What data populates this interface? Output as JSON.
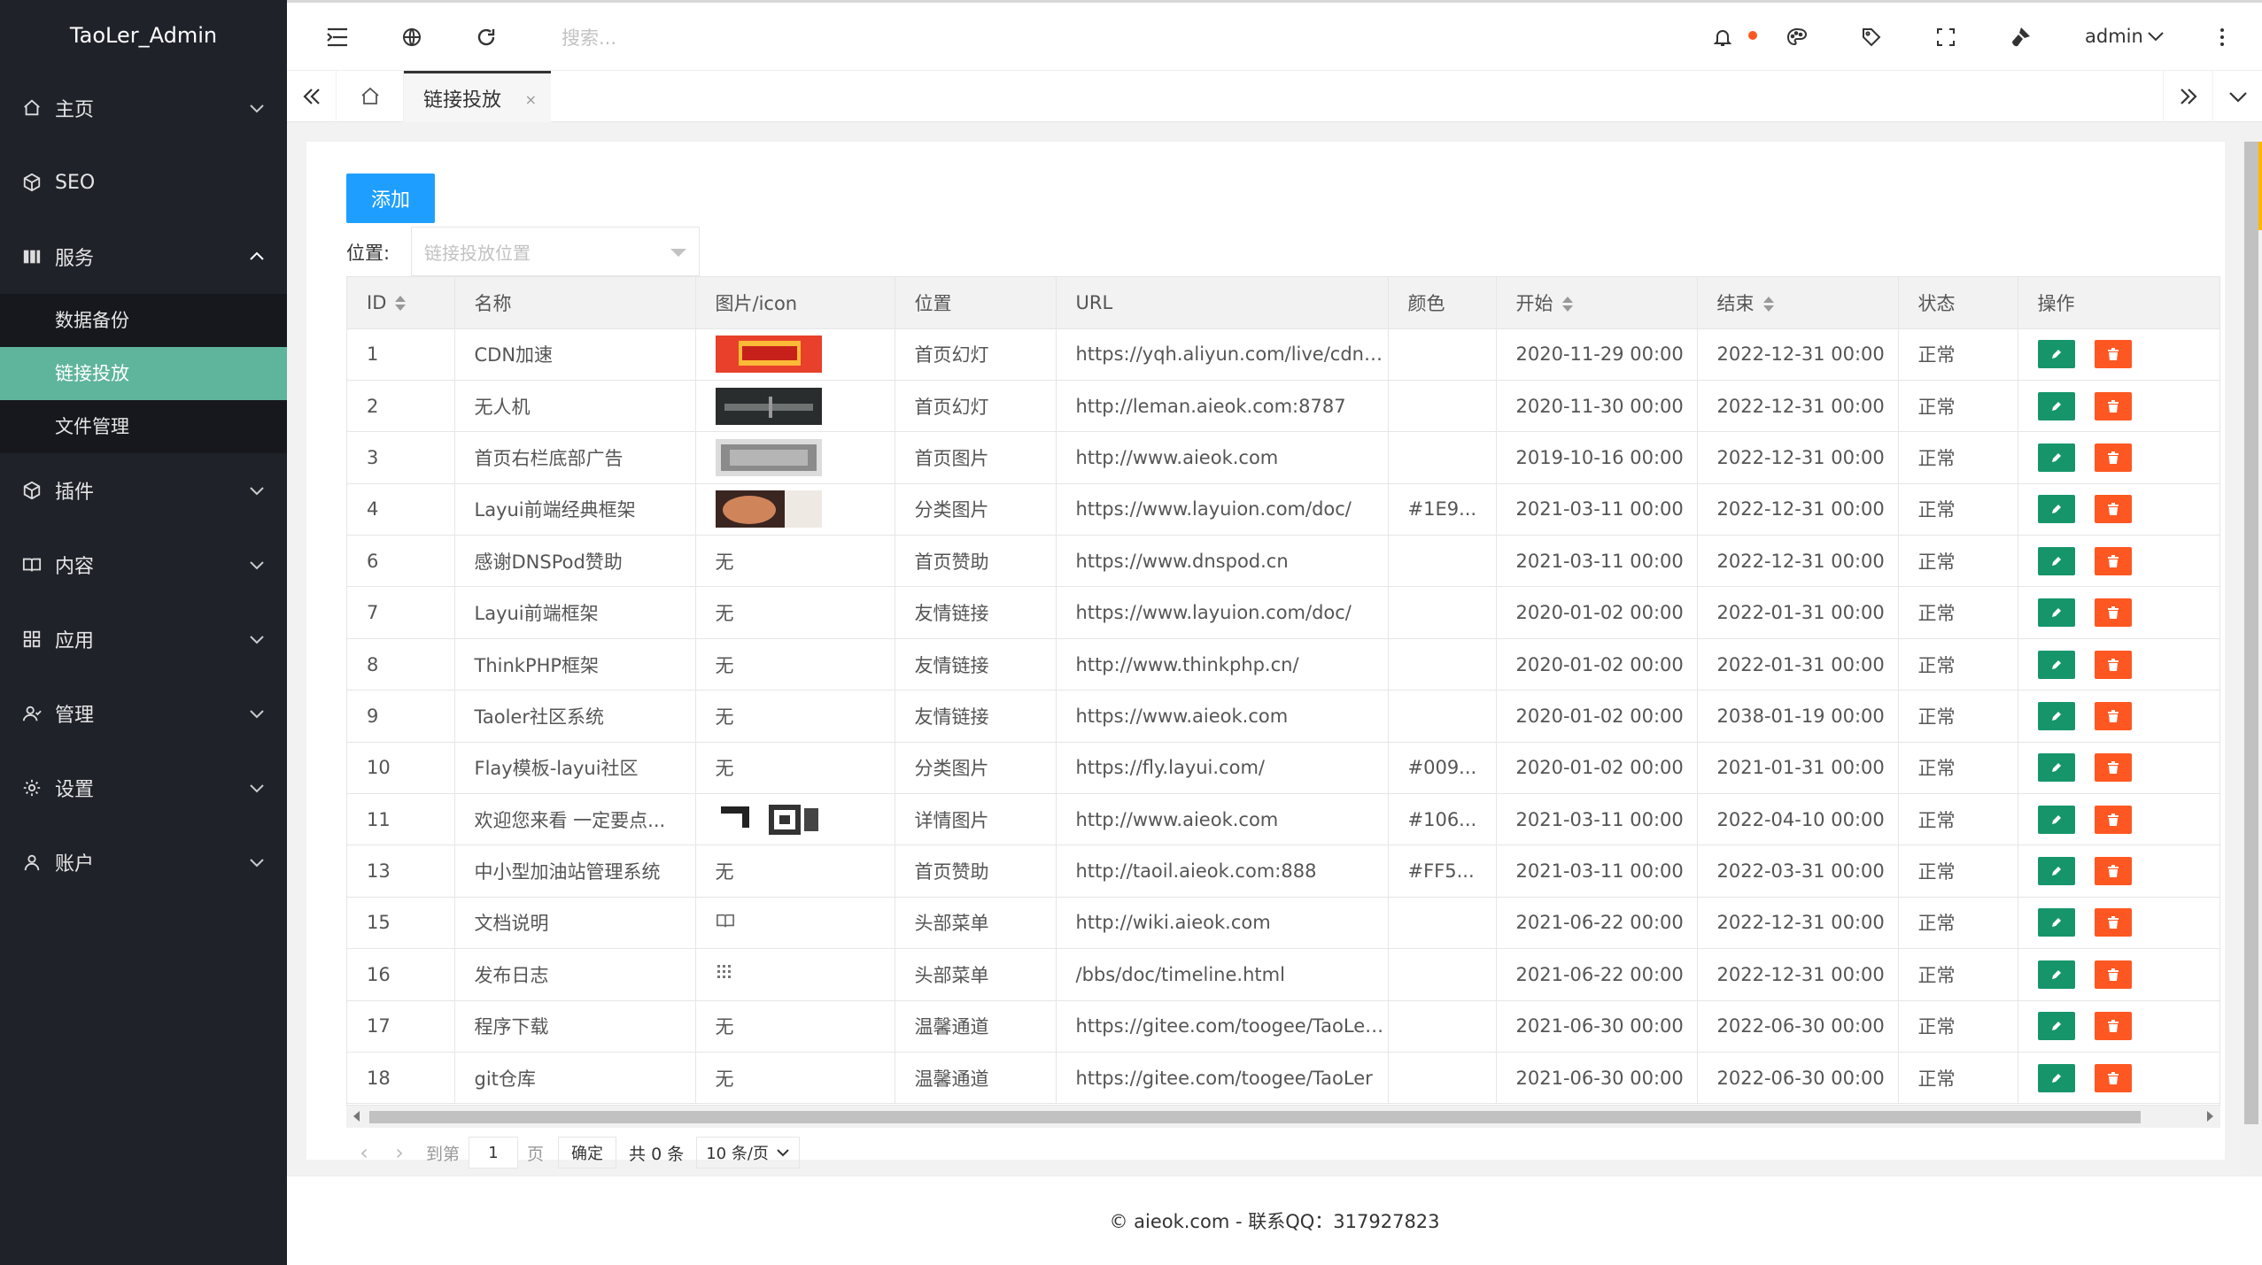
{
  "app": {
    "title": "TaoLer_Admin"
  },
  "sidebar": {
    "items": [
      {
        "label": "主页",
        "icon": "home-icon",
        "expanded": false
      },
      {
        "label": "SEO",
        "icon": "cube-icon",
        "expanded": false
      },
      {
        "label": "服务",
        "icon": "grid-icon",
        "expanded": true,
        "children": [
          {
            "label": "数据备份"
          },
          {
            "label": "链接投放",
            "active": true
          },
          {
            "label": "文件管理"
          }
        ]
      },
      {
        "label": "插件",
        "icon": "cube-icon",
        "expanded": false
      },
      {
        "label": "内容",
        "icon": "book-icon",
        "expanded": false
      },
      {
        "label": "应用",
        "icon": "apps-icon",
        "expanded": false
      },
      {
        "label": "管理",
        "icon": "user-icon",
        "expanded": false
      },
      {
        "label": "设置",
        "icon": "gear-icon",
        "expanded": false
      },
      {
        "label": "账户",
        "icon": "person-icon",
        "expanded": false
      }
    ]
  },
  "header": {
    "search_placeholder": "搜索...",
    "user": "admin"
  },
  "tabs": {
    "active_label": "链接投放",
    "close": "×"
  },
  "toolbar": {
    "add_label": "添加",
    "position_label": "位置:",
    "position_placeholder": "链接投放位置"
  },
  "table": {
    "headers": [
      "ID",
      "名称",
      "图片/icon",
      "位置",
      "URL",
      "颜色",
      "开始",
      "结束",
      "状态",
      "操作"
    ],
    "rows": [
      {
        "id": "1",
        "name": "CDN加速",
        "img": "banner-red",
        "pos": "首页幻灯",
        "url": "https://yqh.aliyun.com/live/cdnca...",
        "color": "",
        "start": "2020-11-29 00:00",
        "end": "2022-12-31 00:00",
        "status": "正常"
      },
      {
        "id": "2",
        "name": "无人机",
        "img": "banner-dark",
        "pos": "首页幻灯",
        "url": "http://leman.aieok.com:8787",
        "color": "",
        "start": "2020-11-30 00:00",
        "end": "2022-12-31 00:00",
        "status": "正常"
      },
      {
        "id": "3",
        "name": "首页右栏底部广告",
        "img": "banner-grey",
        "pos": "首页图片",
        "url": "http://www.aieok.com",
        "color": "",
        "start": "2019-10-16 00:00",
        "end": "2022-12-31 00:00",
        "status": "正常"
      },
      {
        "id": "4",
        "name": "Layui前端经典框架",
        "img": "banner-brown",
        "pos": "分类图片",
        "url": "https://www.layuion.com/doc/",
        "color": "#1E9...",
        "start": "2021-03-11 00:00",
        "end": "2022-12-31 00:00",
        "status": "正常"
      },
      {
        "id": "6",
        "name": "感谢DNSPod赞助",
        "img": "无",
        "pos": "首页赞助",
        "url": "https://www.dnspod.cn",
        "color": "",
        "start": "2021-03-11 00:00",
        "end": "2022-12-31 00:00",
        "status": "正常"
      },
      {
        "id": "7",
        "name": "Layui前端框架",
        "img": "无",
        "pos": "友情链接",
        "url": "https://www.layuion.com/doc/",
        "color": "",
        "start": "2020-01-02 00:00",
        "end": "2022-01-31 00:00",
        "status": "正常"
      },
      {
        "id": "8",
        "name": "ThinkPHP框架",
        "img": "无",
        "pos": "友情链接",
        "url": "http://www.thinkphp.cn/",
        "color": "",
        "start": "2020-01-02 00:00",
        "end": "2022-01-31 00:00",
        "status": "正常"
      },
      {
        "id": "9",
        "name": "Taoler社区系统",
        "img": "无",
        "pos": "友情链接",
        "url": "https://www.aieok.com",
        "color": "",
        "start": "2020-01-02 00:00",
        "end": "2038-01-19 00:00",
        "status": "正常"
      },
      {
        "id": "10",
        "name": "Flay模板-layui社区",
        "img": "无",
        "pos": "分类图片",
        "url": "https://fly.layui.com/",
        "color": "#009...",
        "start": "2020-01-02 00:00",
        "end": "2021-01-31 00:00",
        "status": "正常"
      },
      {
        "id": "11",
        "name": "欢迎您来看 一定要点...",
        "img": "banner-qr",
        "pos": "详情图片",
        "url": "http://www.aieok.com",
        "color": "#106...",
        "start": "2021-03-11 00:00",
        "end": "2022-04-10 00:00",
        "status": "正常"
      },
      {
        "id": "13",
        "name": "中小型加油站管理系统",
        "img": "无",
        "pos": "首页赞助",
        "url": "http://taoil.aieok.com:888",
        "color": "#FF5...",
        "start": "2021-03-11 00:00",
        "end": "2022-03-31 00:00",
        "status": "正常"
      },
      {
        "id": "15",
        "name": "文档说明",
        "img": "book",
        "pos": "头部菜单",
        "url": "http://wiki.aieok.com",
        "color": "",
        "start": "2021-06-22 00:00",
        "end": "2022-12-31 00:00",
        "status": "正常"
      },
      {
        "id": "16",
        "name": "发布日志",
        "img": "calendar",
        "pos": "头部菜单",
        "url": "/bbs/doc/timeline.html",
        "color": "",
        "start": "2021-06-22 00:00",
        "end": "2022-12-31 00:00",
        "status": "正常"
      },
      {
        "id": "17",
        "name": "程序下载",
        "img": "无",
        "pos": "温馨通道",
        "url": "https://gitee.com/toogee/TaoLer/r...",
        "color": "",
        "start": "2021-06-30 00:00",
        "end": "2022-06-30 00:00",
        "status": "正常"
      },
      {
        "id": "18",
        "name": "git仓库",
        "img": "无",
        "pos": "温馨通道",
        "url": "https://gitee.com/toogee/TaoLer",
        "color": "",
        "start": "2021-06-30 00:00",
        "end": "2022-06-30 00:00",
        "status": "正常"
      }
    ]
  },
  "pager": {
    "goto": "到第",
    "page_value": "1",
    "page_unit": "页",
    "confirm": "确定",
    "total": "共 0 条",
    "page_size": "10 条/页"
  },
  "footer": {
    "text": "© aieok.com - 联系QQ：317927823"
  },
  "colors": {
    "sidebar_bg": "#20222a",
    "active_item": "#5fb49c",
    "primary": "#1e9fff",
    "edit": "#16956b",
    "delete": "#ff5722"
  }
}
